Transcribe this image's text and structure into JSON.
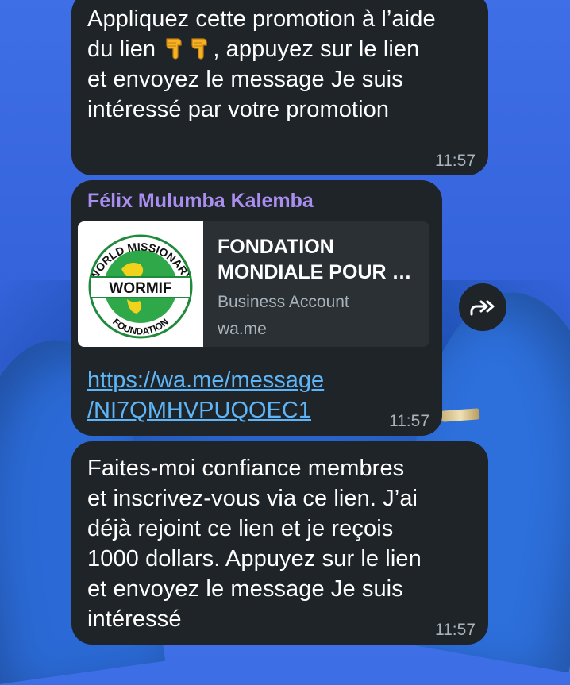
{
  "messages": [
    {
      "text_before": "Appliquez cette promotion à l’aide\ndu lien ",
      "emoji": [
        "backhand-index-pointing-down",
        "backhand-index-pointing-down"
      ],
      "text_after": ", appuyez sur le lien\net envoyez le message Je suis\nintéressé par votre promotion",
      "time": "11:57"
    },
    {
      "sender": "Félix Mulumba Kalemba",
      "preview": {
        "title": "FONDATION\nMONDIALE POUR …",
        "subtitle": "Business Account",
        "host": "wa.me",
        "logo_text_top": "WORLD MISSIONARY",
        "logo_text_center": "WORMIF",
        "logo_text_bottom": "FOUNDATION"
      },
      "link_line1": "https://wa.me/message",
      "link_line2": "/NI7QMHVPUQOEC1",
      "time": "11:57"
    },
    {
      "text": "Faites-moi confiance membres\net inscrivez-vous via ce lien. J’ai\ndéjà rejoint ce lien et je reçois\n1000 dollars. Appuyez sur le lien\net envoyez le message Je suis\nintéressé",
      "time": "11:57"
    }
  ],
  "forward_button": {
    "icon": "forward-arrow-icon"
  },
  "colors": {
    "bubble": "#1e2428",
    "sender_name": "#a98ef0",
    "link": "#5eb5f7",
    "time": "#a9b3bb",
    "background": "#3564dd"
  }
}
